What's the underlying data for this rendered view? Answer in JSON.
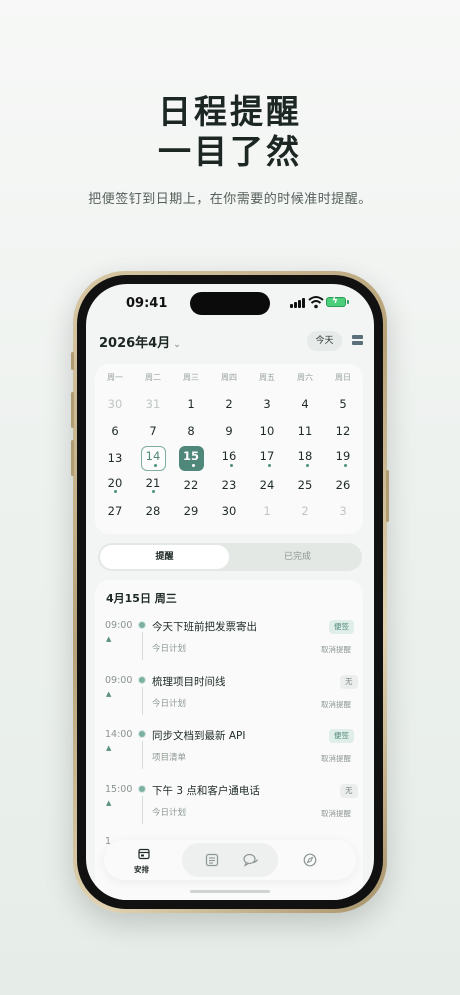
{
  "hero": {
    "title_line1": "日程提醒",
    "title_line2": "一目了然",
    "subtitle": "把便签钉到日期上，在你需要的时候准时提醒。"
  },
  "status_bar": {
    "time": "09:41"
  },
  "header": {
    "month_label": "2026年4月",
    "today_button": "今天"
  },
  "calendar": {
    "weekdays": [
      "周一",
      "周二",
      "周三",
      "周四",
      "周五",
      "周六",
      "周日"
    ],
    "weeks": [
      [
        "30",
        "31",
        "1",
        "2",
        "3",
        "4",
        "5"
      ],
      [
        "6",
        "7",
        "8",
        "9",
        "10",
        "11",
        "12"
      ],
      [
        "13",
        "14",
        "15",
        "16",
        "17",
        "18",
        "19"
      ],
      [
        "20",
        "21",
        "22",
        "23",
        "24",
        "25",
        "26"
      ],
      [
        "27",
        "28",
        "29",
        "30",
        "1",
        "2",
        "3"
      ]
    ],
    "today": "14",
    "selected": "15"
  },
  "segment": {
    "active": "提醒",
    "inactive": "已完成"
  },
  "list": {
    "date_heading": "4月15日 周三",
    "items": [
      {
        "time": "09:00",
        "title": "今天下班前把发票寄出",
        "category": "今日计划",
        "badge": "便签",
        "action": "取消提醒"
      },
      {
        "time": "09:00",
        "title": "梳理项目时间线",
        "category": "今日计划",
        "badge": "无",
        "action": "取消提醒"
      },
      {
        "time": "14:00",
        "title": "同步文档到最新 API",
        "category": "项目清单",
        "badge": "便签",
        "action": "取消提醒"
      },
      {
        "time": "15:00",
        "title": "下午 3 点和客户通电话",
        "category": "今日计划",
        "badge": "无",
        "action": "取消提醒"
      }
    ],
    "partial_time": "1"
  },
  "tabbar": {
    "schedule_label": "安排"
  },
  "colors": {
    "accent": "#4f877a",
    "background": "#eef2ef",
    "frame": "#b7a279"
  }
}
